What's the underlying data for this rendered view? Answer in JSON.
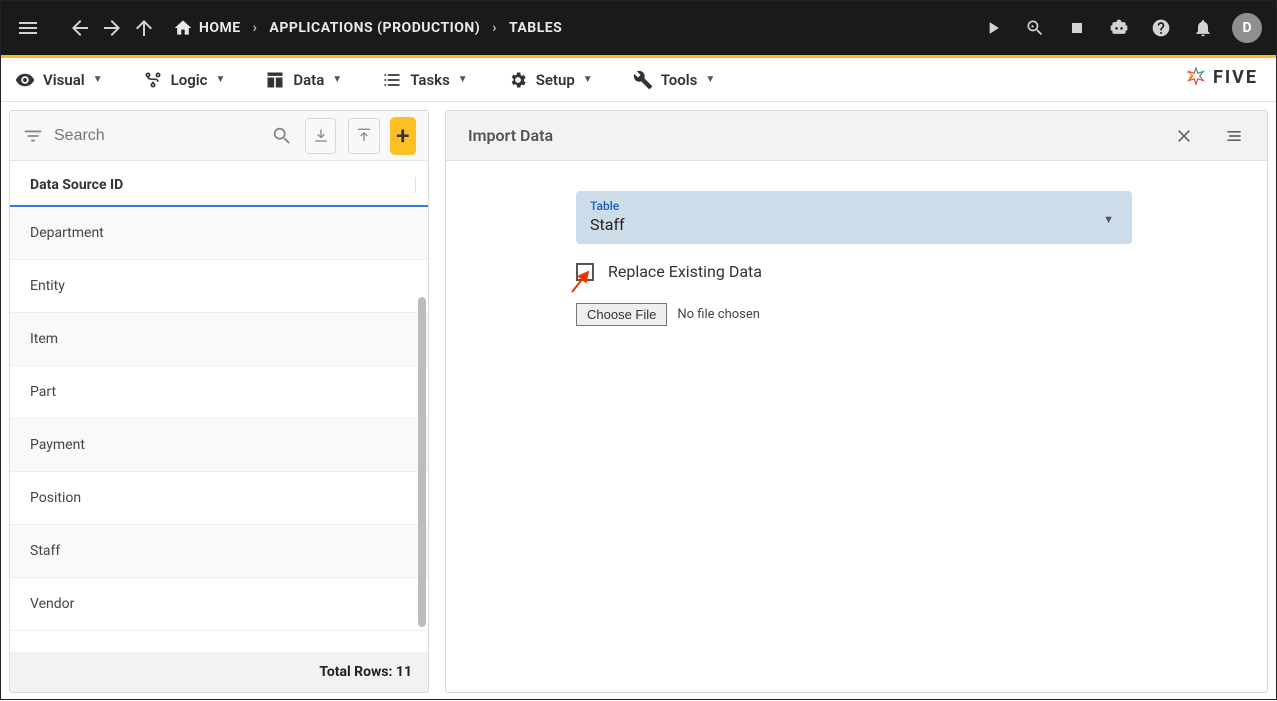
{
  "topbar": {
    "avatar_letter": "D"
  },
  "breadcrumb": {
    "home": "HOME",
    "segment1": "APPLICATIONS (PRODUCTION)",
    "segment2": "TABLES"
  },
  "menubar": {
    "visual": "Visual",
    "logic": "Logic",
    "data": "Data",
    "tasks": "Tasks",
    "setup": "Setup",
    "tools": "Tools"
  },
  "brand": {
    "name": "FIVE"
  },
  "left_panel": {
    "search_placeholder": "Search",
    "header": "Data Source ID",
    "items": [
      "Department",
      "Entity",
      "Item",
      "Part",
      "Payment",
      "Position",
      "Staff",
      "Vendor"
    ],
    "footer_label": "Total Rows:",
    "footer_value": "11"
  },
  "right_panel": {
    "title": "Import Data",
    "table_label": "Table",
    "table_value": "Staff",
    "replace_label": "Replace Existing Data",
    "choose_file": "Choose File",
    "file_status": "No file chosen"
  }
}
